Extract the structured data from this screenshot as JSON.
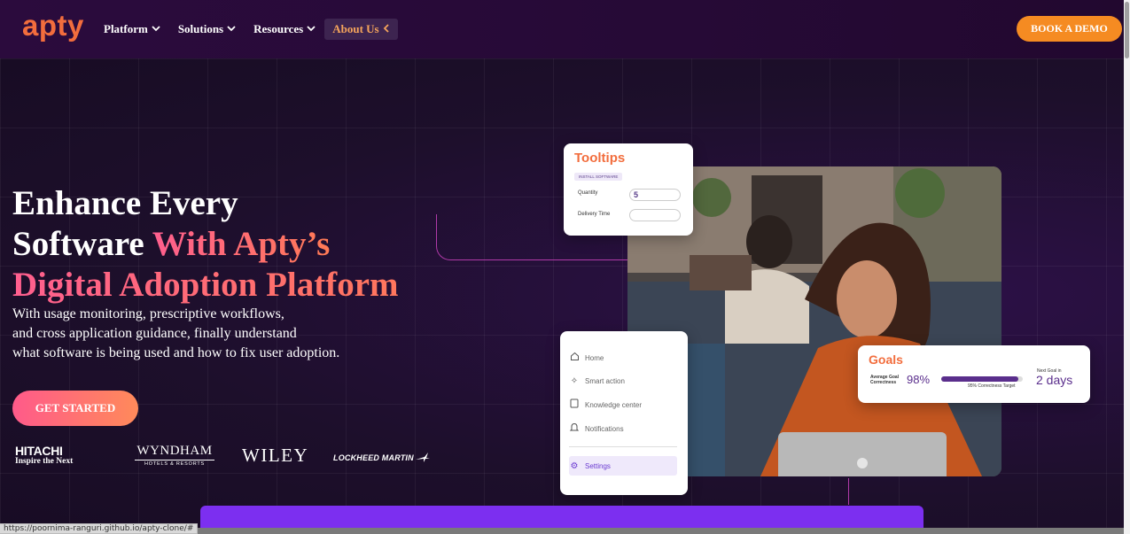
{
  "nav": {
    "logo": "apty",
    "items": [
      {
        "label": "Platform",
        "icon": "chevron-down-icon"
      },
      {
        "label": "Solutions",
        "icon": "chevron-down-icon"
      },
      {
        "label": "Resources",
        "icon": "chevron-down-icon"
      },
      {
        "label": "About Us",
        "icon": "chevron-left-icon"
      }
    ],
    "cta": "BOOK A DEMO"
  },
  "hero": {
    "headline_1": "Enhance Every",
    "headline_2": "Software ",
    "headline_accent_1": "With Apty’s",
    "headline_accent_2": "Digital Adoption Platform",
    "subtext_1": "With usage monitoring, prescriptive workflows,",
    "subtext_2": "and cross application guidance, finally understand",
    "subtext_3": "what software is being used and how to fix user adoption.",
    "cta": "GET STARTED"
  },
  "clients": {
    "hitachi": "HITACHI",
    "hitachi_tagline": "Inspire the Next",
    "wyndham": "WYNDHAM",
    "wyndham_tagline": "HOTELS & RESORTS",
    "wiley": "WILEY",
    "lockheed": "LOCKHEED MARTIN"
  },
  "tooltips_card": {
    "title": "Tooltips",
    "tag": "INSTALL SOFTWARE",
    "quantity_label": "Quantity",
    "quantity_value": "5",
    "delivery_label": "Delivery Time"
  },
  "goals_card": {
    "title": "Goals",
    "avg_label_1": "Average Goal",
    "avg_label_2": "Correctness",
    "avg_value": "98%",
    "progress": 0.95,
    "target_label": "95% Correctness Target",
    "next_label_1": "Next Goal in",
    "next_value": "2 days"
  },
  "menu_card": {
    "items": [
      {
        "label": "Home",
        "icon": "home-icon"
      },
      {
        "label": "Smart action",
        "icon": "sparkle-icon"
      },
      {
        "label": "Knowledge center",
        "icon": "book-icon"
      },
      {
        "label": "Notifications",
        "icon": "bell-icon"
      },
      {
        "label": "Settings",
        "icon": "gear-icon"
      }
    ]
  },
  "status_bar": {
    "url": "https://poornima-ranguri.github.io/apty-clone/#"
  },
  "colors": {
    "brand_orange": "#f26d3d",
    "cta_orange": "#f58b22",
    "accent_purple": "#7c2ff0"
  }
}
